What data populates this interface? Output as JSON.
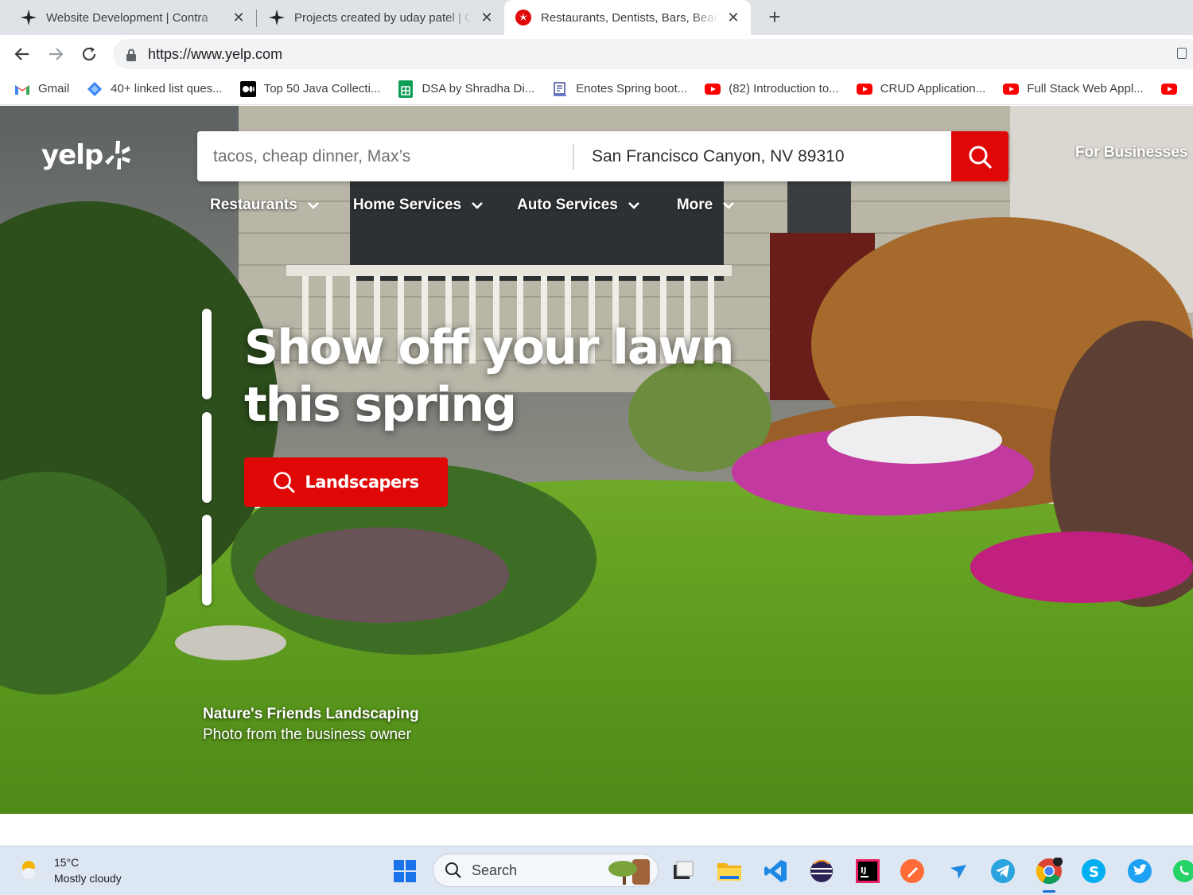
{
  "browser": {
    "tabs": [
      {
        "title": "Website Development | Contra",
        "active": false
      },
      {
        "title": "Projects created by uday patel | Contra",
        "active": false
      },
      {
        "title": "Restaurants, Dentists, Bars, Beauty Salons",
        "active": true
      }
    ],
    "url": "https://www.yelp.com",
    "bookmarks": [
      {
        "label": "Gmail",
        "icon": "gmail-icon"
      },
      {
        "label": "40+ linked list ques...",
        "icon": "diamond-icon"
      },
      {
        "label": "Top 50 Java Collecti...",
        "icon": "medium-icon"
      },
      {
        "label": "DSA by Shradha Di...",
        "icon": "sheets-icon"
      },
      {
        "label": "Enotes Spring boot...",
        "icon": "enotes-icon"
      },
      {
        "label": "(82) Introduction to...",
        "icon": "youtube-icon"
      },
      {
        "label": "CRUD Application...",
        "icon": "youtube-icon"
      },
      {
        "label": "Full Stack Web Appl...",
        "icon": "youtube-icon"
      }
    ]
  },
  "yelp": {
    "logo_text": "yelp",
    "search": {
      "find_placeholder": "tacos, cheap dinner, Max’s",
      "near_value": "San Francisco Canyon, NV 89310"
    },
    "for_businesses": "For Businesses",
    "categories": [
      "Restaurants",
      "Home Services",
      "Auto Services",
      "More"
    ],
    "hero": {
      "headline_line1": "Show off your lawn",
      "headline_line2": "this spring",
      "cta_label": "Landscapers",
      "credit_business": "Nature's Friends Landscaping",
      "credit_sub": "Photo from the business owner"
    },
    "colors": {
      "brand_red": "#e00707",
      "white": "#ffffff"
    }
  },
  "taskbar": {
    "weather_temp": "15°C",
    "weather_desc": "Mostly cloudy",
    "search_label": "Search",
    "apps": [
      "file-explorer",
      "vscode",
      "eclipse",
      "intellij",
      "postman",
      "arrow-app",
      "telegram",
      "chrome",
      "skype",
      "twitter",
      "whatsapp"
    ]
  }
}
